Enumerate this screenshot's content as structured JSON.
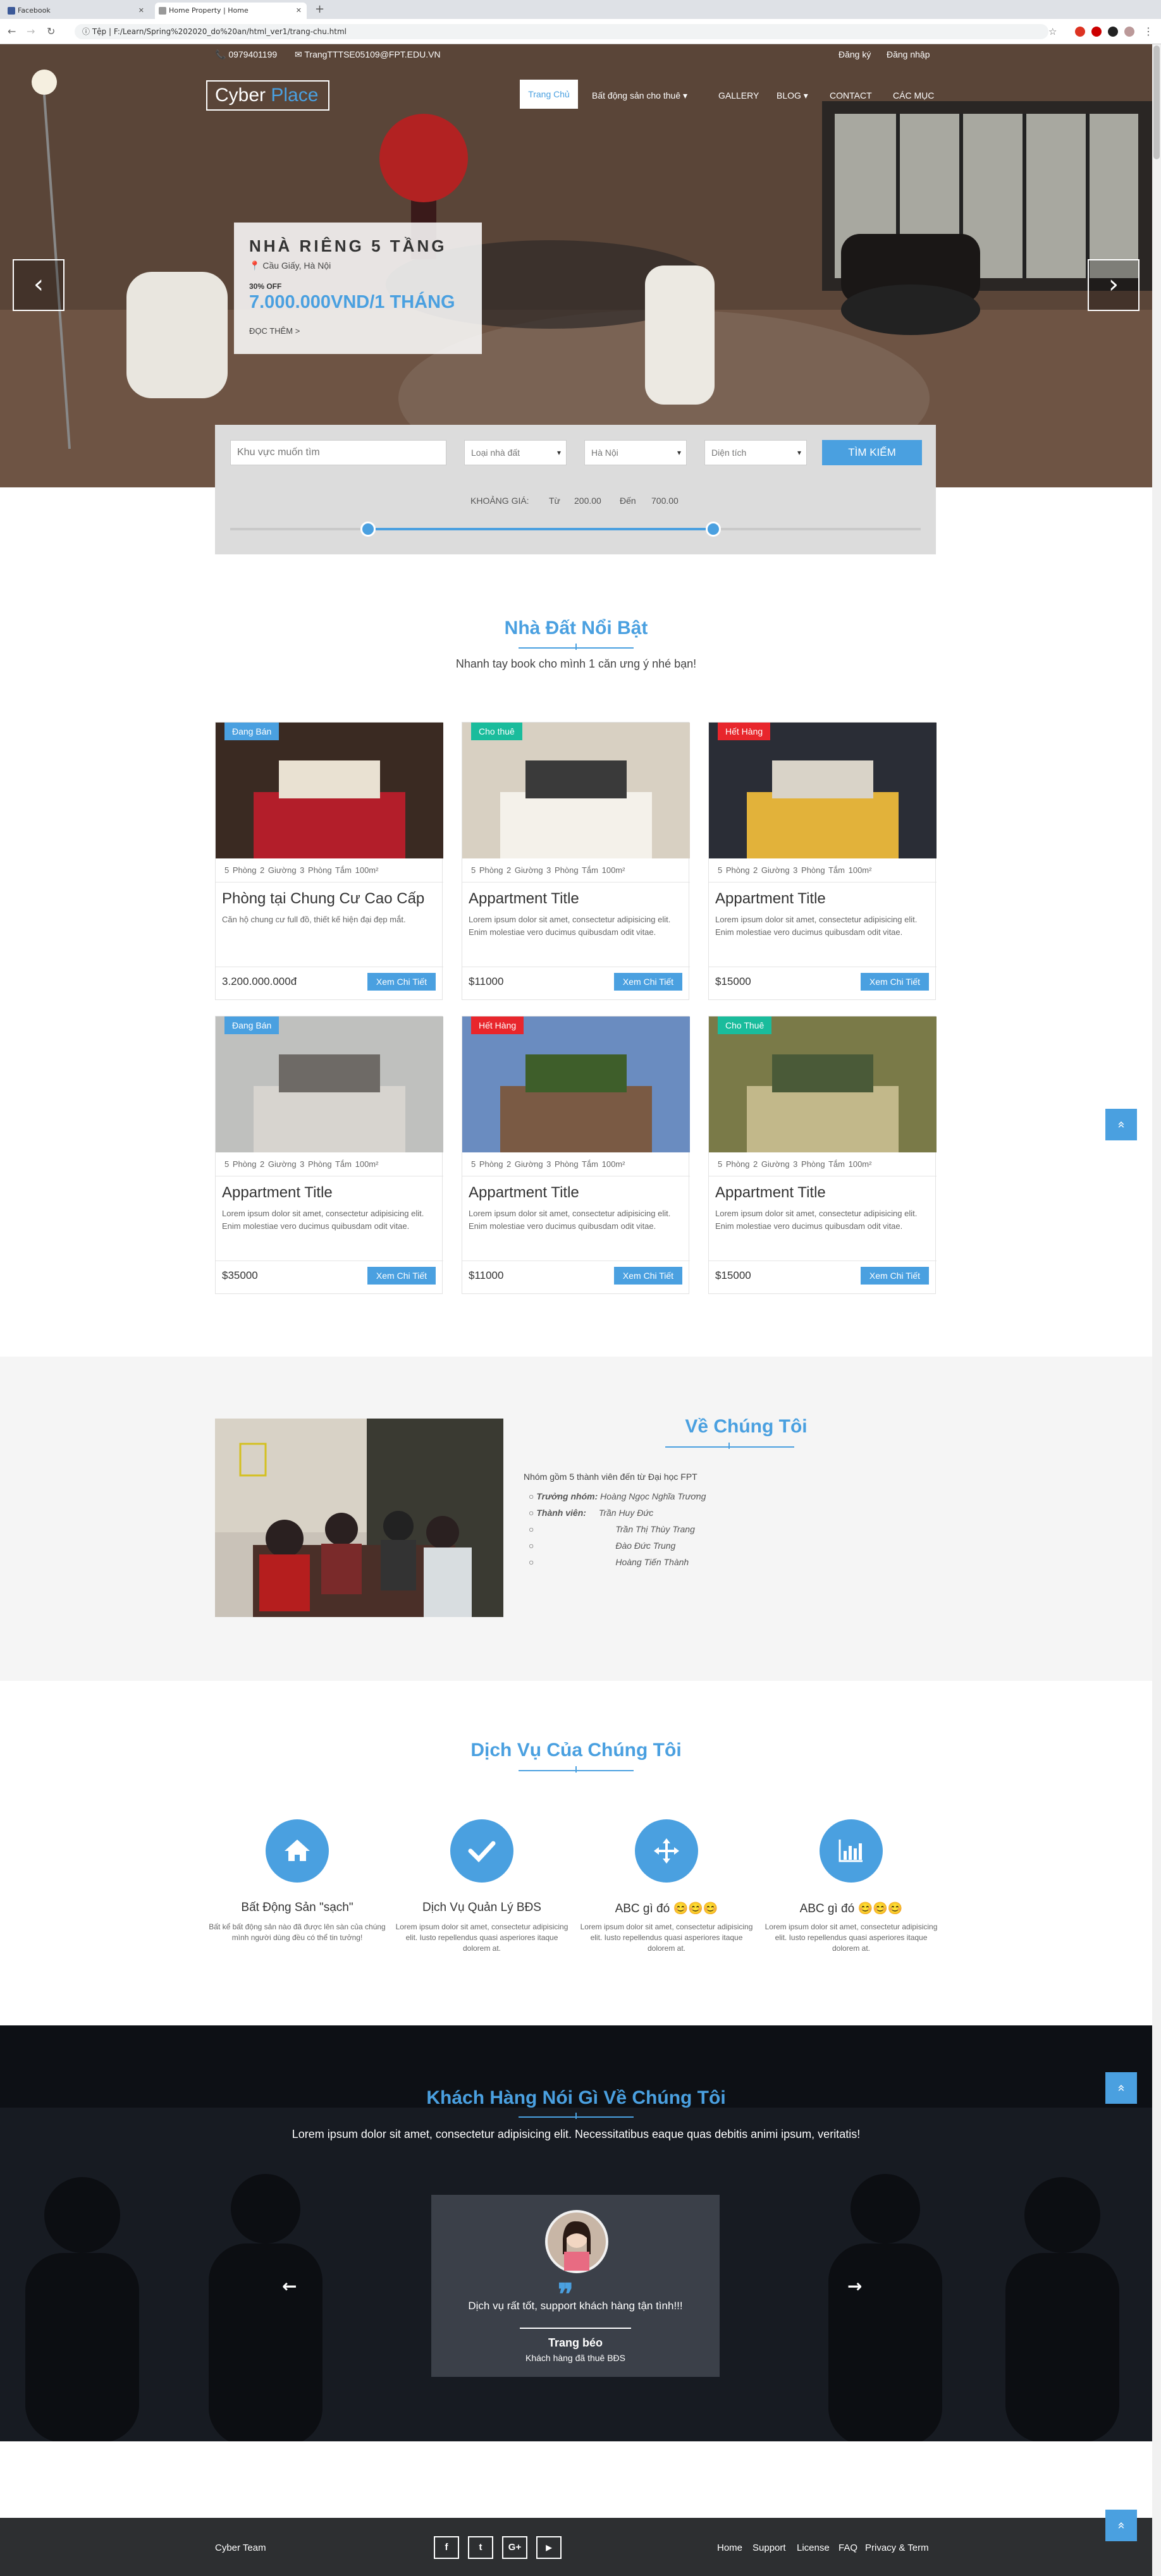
{
  "browser": {
    "tabs": [
      {
        "label": "Facebook"
      },
      {
        "label": "Home Property | Home"
      }
    ],
    "url_prefix": "Tệp",
    "url": "F:/Learn/Spring%202020_do%20an/html_ver1/trang-chu.html"
  },
  "topbar": {
    "phone": "0979401199",
    "email": "TrangTTTSE05109@FPT.EDU.VN",
    "register": "Đăng ký",
    "login": "Đăng nhập"
  },
  "logo": {
    "part1": "Cyber ",
    "part2": "Place"
  },
  "nav": {
    "items": [
      "Trang Chủ",
      "Bất động sản cho thuê ▾",
      "GALLERY",
      "BLOG ▾",
      "CONTACT",
      "CÁC MỤC"
    ]
  },
  "hero": {
    "title": "NHÀ RIÊNG 5 TẦNG",
    "location": "Cầu Giấy, Hà Nội",
    "off": "30% OFF",
    "price": "7.000.000VND/1 THÁNG",
    "more": "ĐỌC THÊM >",
    "prev": "‹",
    "next": "›"
  },
  "search": {
    "placeholder": "Khu vực muốn tìm",
    "type": "Loại nhà đất",
    "city": "Hà Nội",
    "area": "Diện tích",
    "button": "TÌM KIẾM",
    "range_label": "KHOẢNG GIÁ:",
    "from_label": "Từ",
    "from_value": "200.00",
    "to_label": "Đến",
    "to_value": "700.00",
    "slider_low": 0.2,
    "slider_high": 0.7
  },
  "featured": {
    "title": "Nhà Đất Nổi Bật",
    "subtitle": "Nhanh tay book cho mình 1 căn ưng ý nhé bạn!",
    "cards": [
      {
        "badge": "Đang Bán",
        "badge_color": "#4aa0e0",
        "specs": "5 Phòng   2 Giường   3 Phòng Tắm   100m²",
        "title": "Phòng tại Chung Cư Cao Cấp",
        "desc": "Căn hộ chung cư full đồ, thiết kế hiện đại đẹp mắt.",
        "price": "3.200.000.000đ",
        "button": "Xem Chi Tiết"
      },
      {
        "badge": "Cho thuê",
        "badge_color": "#1abc9c",
        "specs": "5 Phòng   2 Giường   3 Phòng Tắm   100m²",
        "title": "Appartment Title",
        "desc": "Lorem ipsum dolor sit amet, consectetur adipisicing elit. Enim molestiae vero ducimus quibusdam odit vitae.",
        "price": "$11000",
        "button": "Xem Chi Tiết"
      },
      {
        "badge": "Hết Hàng",
        "badge_color": "#e8262c",
        "specs": "5 Phòng   2 Giường   3 Phòng Tắm   100m²",
        "title": "Appartment Title",
        "desc": "Lorem ipsum dolor sit amet, consectetur adipisicing elit. Enim molestiae vero ducimus quibusdam odit vitae.",
        "price": "$15000",
        "button": "Xem Chi Tiết"
      },
      {
        "badge": "Đang Bán",
        "badge_color": "#4aa0e0",
        "specs": "5 Phòng   2 Giường   3 Phòng Tắm   100m²",
        "title": "Appartment Title",
        "desc": "Lorem ipsum dolor sit amet, consectetur adipisicing elit. Enim molestiae vero ducimus quibusdam odit vitae.",
        "price": "$35000",
        "button": "Xem Chi Tiết"
      },
      {
        "badge": "Hết Hàng",
        "badge_color": "#e8262c",
        "specs": "5 Phòng   2 Giường   3 Phòng Tắm   100m²",
        "title": "Appartment Title",
        "desc": "Lorem ipsum dolor sit amet, consectetur adipisicing elit. Enim molestiae vero ducimus quibusdam odit vitae.",
        "price": "$11000",
        "button": "Xem Chi Tiết"
      },
      {
        "badge": "Cho Thuê",
        "badge_color": "#1abc9c",
        "specs": "5 Phòng   2 Giường   3 Phòng Tắm   100m²",
        "title": "Appartment Title",
        "desc": "Lorem ipsum dolor sit amet, consectetur adipisicing elit. Enim molestiae vero ducimus quibusdam odit vitae.",
        "price": "$15000",
        "button": "Xem Chi Tiết"
      }
    ]
  },
  "about": {
    "title": "Về Chúng Tôi",
    "intro": "Nhóm gồm 5 thành viên đến từ Đại học FPT",
    "leader_label": "Trưởng nhóm:",
    "leader": "Hoàng Ngọc Nghĩa Trương",
    "members_label": "Thành viên:",
    "members": [
      "Trần Huy Đức",
      "Trần Thị Thùy Trang",
      "Đào Đức Trung",
      "Hoàng Tiến Thành"
    ]
  },
  "services": {
    "title": "Dịch Vụ Của Chúng Tôi",
    "items": [
      {
        "icon": "home-icon",
        "title": "Bất Động Sản \"sạch\"",
        "desc": "Bất kể bất động sản nào đã được lên sàn của chúng mình người dùng đều có thể tin tưởng!"
      },
      {
        "icon": "check-icon",
        "title": "Dịch Vụ Quản Lý BĐS",
        "desc": "Lorem ipsum dolor sit amet, consectetur adipisicing elit. Iusto repellendus quasi asperiores itaque dolorem at."
      },
      {
        "icon": "move-icon",
        "title": "ABC gì đó 😊😊😊",
        "desc": "Lorem ipsum dolor sit amet, consectetur adipisicing elit. Iusto repellendus quasi asperiores itaque dolorem at."
      },
      {
        "icon": "bar-chart-icon",
        "title": "ABC gì đó 😊😊😊",
        "desc": "Lorem ipsum dolor sit amet, consectetur adipisicing elit. Iusto repellendus quasi asperiores itaque dolorem at."
      }
    ]
  },
  "testimonials": {
    "title": "Khách Hàng Nói Gì Về Chúng Tôi",
    "subtitle": "Lorem ipsum dolor sit amet, consectetur adipisicing elit. Necessitatibus eaque quas debitis animi ipsum, veritatis!",
    "quote": "Dịch vụ rất tốt, support khách hàng tận tình!!!",
    "name": "Trang béo",
    "role": "Khách hàng đã thuê BĐS",
    "prev": "←",
    "next": "→"
  },
  "footer": {
    "brand": "Cyber Team",
    "social": [
      "f",
      "t",
      "G+",
      "▶"
    ],
    "links": [
      "Home",
      "Support",
      "License",
      "FAQ",
      "Privacy & Term"
    ]
  },
  "back_top": "»"
}
